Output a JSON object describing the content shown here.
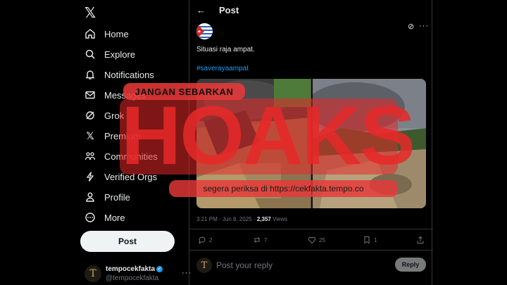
{
  "nav": {
    "items": [
      {
        "label": "Home",
        "icon": "home-icon"
      },
      {
        "label": "Explore",
        "icon": "search-icon"
      },
      {
        "label": "Notifications",
        "icon": "bell-icon"
      },
      {
        "label": "Messages",
        "icon": "mail-icon"
      },
      {
        "label": "Grok",
        "icon": "grok-icon"
      },
      {
        "label": "Premium",
        "icon": "x-premium-icon"
      },
      {
        "label": "Communities",
        "icon": "communities-icon"
      },
      {
        "label": "Verified Orgs",
        "icon": "lightning-icon"
      },
      {
        "label": "Profile",
        "icon": "profile-icon"
      },
      {
        "label": "More",
        "icon": "more-circle-icon"
      }
    ],
    "post_button": "Post"
  },
  "account": {
    "name": "tempocekfakta",
    "handle": "@tempocekfakta",
    "avatar_letter": "T"
  },
  "header": {
    "title": "Post"
  },
  "post": {
    "text": "Situasi raja ampat.",
    "hashtag": "#saverayaampat",
    "time": "3:21 PM · Jun 8, 2025 · ",
    "views_count": "2,357",
    "views_label": " Views",
    "replies": "2",
    "reposts": "7",
    "likes": "25",
    "bookmarks": "1"
  },
  "reply": {
    "placeholder": "Post your reply",
    "button": "Reply"
  },
  "stamp": {
    "top": "JANGAN SEBARKAN",
    "word": "HOAKS",
    "bottom": "segera periksa di https://cekfakta.tempo.co"
  },
  "colors": {
    "accent": "#1d9bf0",
    "stamp_red": "#e82828"
  }
}
